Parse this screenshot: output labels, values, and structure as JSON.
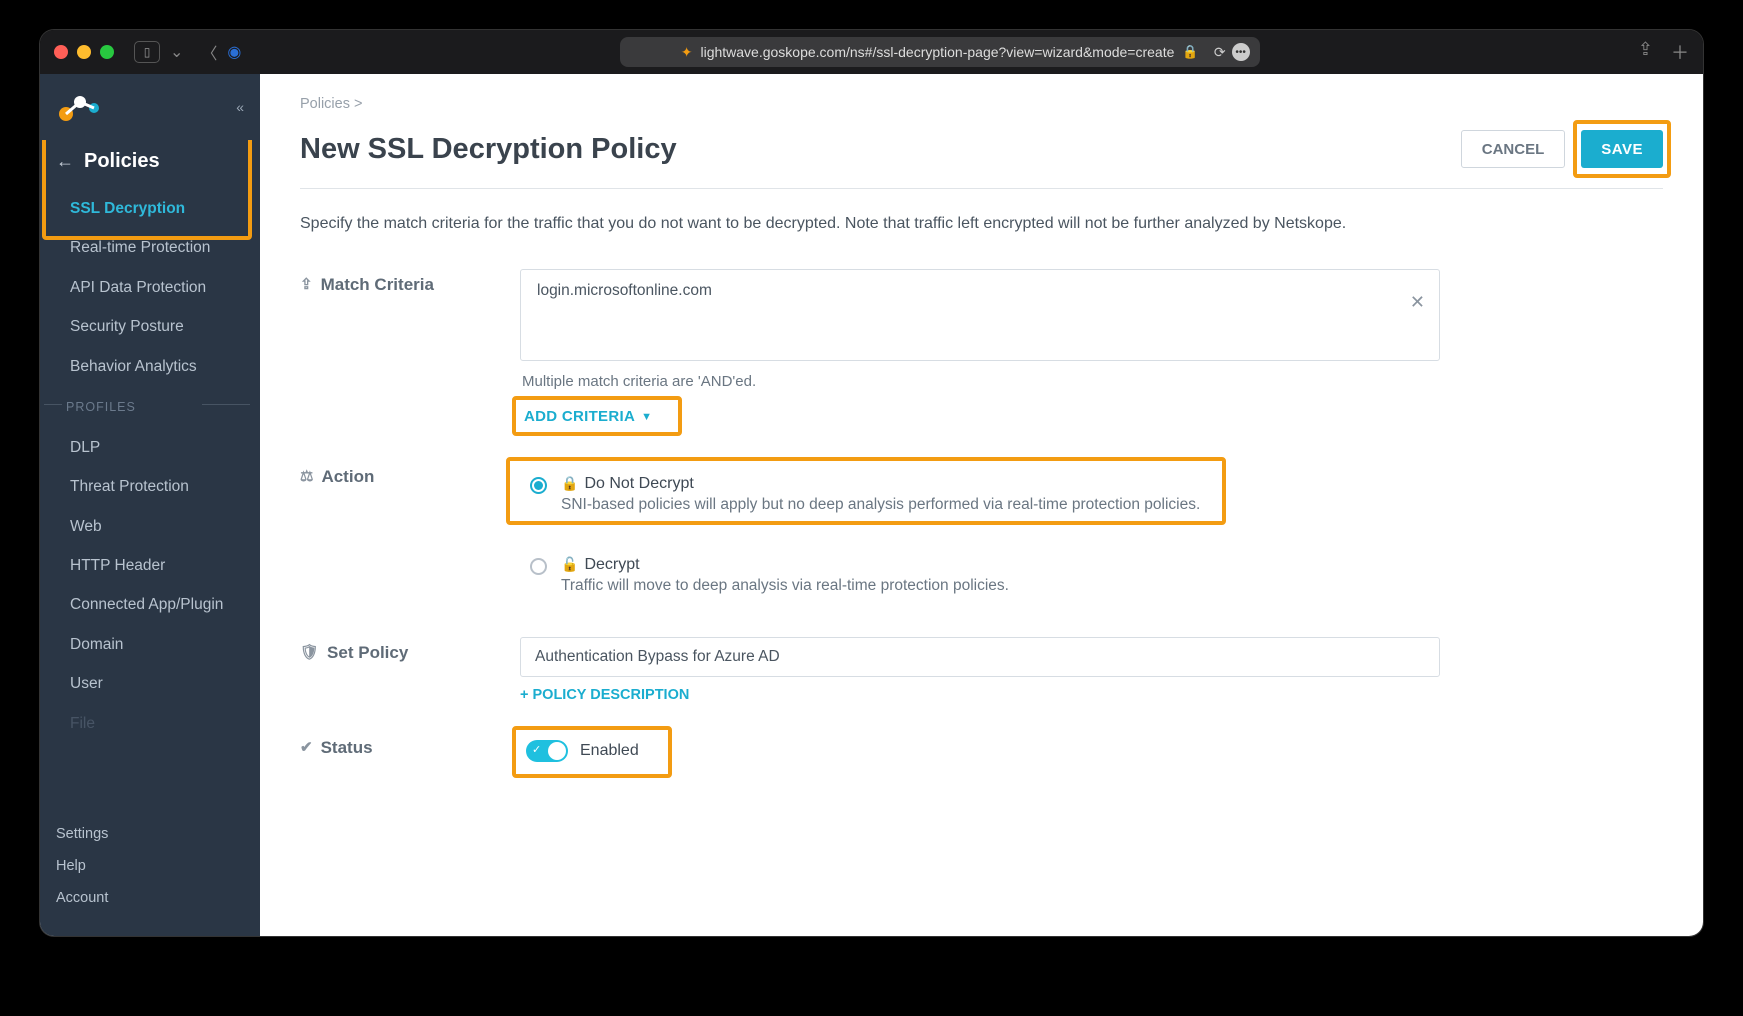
{
  "browser": {
    "url": "lightwave.goskope.com/ns#/ssl-decryption-page?view=wizard&mode=create"
  },
  "sidebar": {
    "title": "Policies",
    "items": [
      {
        "label": "SSL Decryption",
        "active": true
      },
      {
        "label": "Real-time Protection"
      },
      {
        "label": "API Data Protection"
      },
      {
        "label": "Security Posture"
      },
      {
        "label": "Behavior Analytics"
      }
    ],
    "profiles_label": "PROFILES",
    "profiles": [
      {
        "label": "DLP"
      },
      {
        "label": "Threat Protection"
      },
      {
        "label": "Web"
      },
      {
        "label": "HTTP Header"
      },
      {
        "label": "Connected App/Plugin"
      },
      {
        "label": "Domain"
      },
      {
        "label": "User"
      },
      {
        "label": "File"
      }
    ],
    "bottom": [
      "Settings",
      "Help",
      "Account"
    ]
  },
  "breadcrumb": "Policies >",
  "page": {
    "title": "New SSL Decryption Policy",
    "cancel": "CANCEL",
    "save": "SAVE",
    "description": "Specify the match criteria for the traffic that you do not want to be decrypted. Note that traffic left encrypted will not be further analyzed by Netskope."
  },
  "sections": {
    "match": {
      "label": "Match Criteria",
      "criteria_value": "login.microsoftonline.com",
      "hint": "Multiple match criteria are 'AND'ed.",
      "add_label": "ADD CRITERIA"
    },
    "action": {
      "label": "Action",
      "opt1": {
        "title": "Do Not Decrypt",
        "help": "SNI-based policies will apply but no deep analysis performed via real-time protection policies."
      },
      "opt2": {
        "title": "Decrypt",
        "help": "Traffic will move to deep analysis via real-time protection policies."
      }
    },
    "set_policy": {
      "label": "Set Policy",
      "value": "Authentication Bypass for Azure AD",
      "desc_link": "+ POLICY DESCRIPTION"
    },
    "status": {
      "label": "Status",
      "text": "Enabled"
    }
  }
}
